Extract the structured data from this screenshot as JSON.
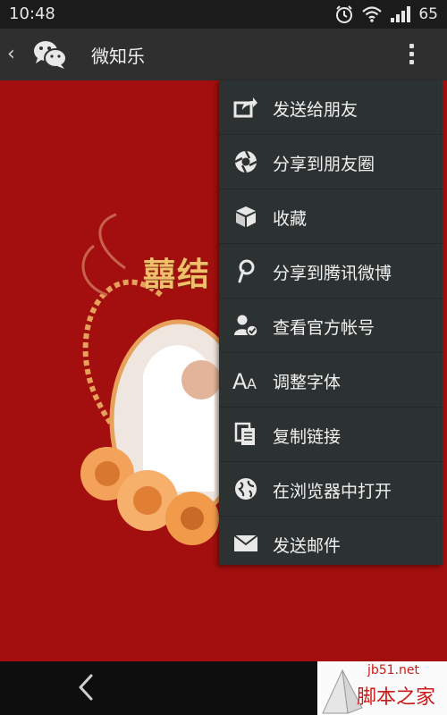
{
  "status_bar": {
    "time": "10:48",
    "battery": "65",
    "icons": [
      "alarm-icon",
      "wifi-icon",
      "signal-icon"
    ]
  },
  "app_bar": {
    "back_icon": "chevron-left-icon",
    "logo_icon": "wechat-icon",
    "title": "微知乐",
    "overflow_icon": "more-vertical-icon"
  },
  "content": {
    "background_color": "#a30f0f",
    "poster_title": "囍结"
  },
  "menu": {
    "items": [
      {
        "label": "发送给朋友",
        "icon": "share-forward-icon"
      },
      {
        "label": "分享到朋友圈",
        "icon": "aperture-icon"
      },
      {
        "label": "收藏",
        "icon": "cube-icon"
      },
      {
        "label": "分享到腾讯微博",
        "icon": "weibo-icon"
      },
      {
        "label": "查看官方帐号",
        "icon": "user-check-icon"
      },
      {
        "label": "调整字体",
        "icon": "font-size-icon"
      },
      {
        "label": "复制链接",
        "icon": "copy-icon"
      },
      {
        "label": "在浏览器中打开",
        "icon": "globe-icon"
      },
      {
        "label": "发送邮件",
        "icon": "mail-icon"
      }
    ]
  },
  "nav_bar": {
    "back_icon": "nav-back-icon"
  },
  "watermark": {
    "domain": "jb51.net",
    "text": "脚本之家"
  }
}
